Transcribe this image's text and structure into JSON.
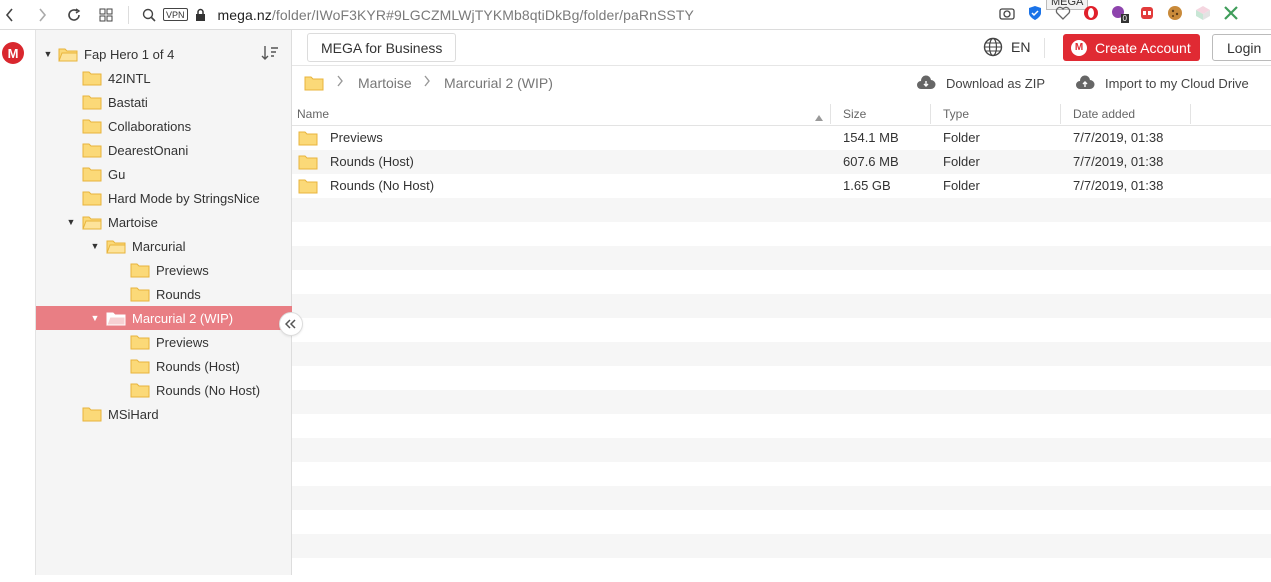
{
  "browser": {
    "url_host": "mega.nz",
    "url_path": "/folder/IWoF3KYR#9LGCZMLWjTYKMb8qtiDkBg/folder/paRnSSTY",
    "vpn_label": "VPN",
    "tooltip": "MEGA",
    "badge_count": "0"
  },
  "logo_letter": "M",
  "tree": {
    "root": "Fap Hero 1 of 4",
    "items": [
      {
        "label": "42INTL"
      },
      {
        "label": "Bastati"
      },
      {
        "label": "Collaborations"
      },
      {
        "label": "DearestOnani"
      },
      {
        "label": "Gu"
      },
      {
        "label": "Hard Mode by StringsNice"
      },
      {
        "label": "Martoise"
      },
      {
        "label": "Marcurial"
      },
      {
        "label": "Previews"
      },
      {
        "label": "Rounds"
      },
      {
        "label": "Marcurial 2 (WIP)"
      },
      {
        "label": "Previews"
      },
      {
        "label": "Rounds (Host)"
      },
      {
        "label": "Rounds (No Host)"
      },
      {
        "label": "MSiHard"
      }
    ]
  },
  "topbar": {
    "business": "MEGA for Business",
    "language": "EN",
    "create_account": "Create Account",
    "create_icon": "M",
    "login": "Login"
  },
  "breadcrumb": {
    "items": [
      "Martoise",
      "Marcurial 2 (WIP)"
    ],
    "download_zip": "Download as ZIP",
    "import": "Import to my Cloud Drive"
  },
  "table": {
    "headers": {
      "name": "Name",
      "size": "Size",
      "type": "Type",
      "date": "Date added"
    },
    "rows": [
      {
        "name": "Previews",
        "size": "154.1 MB",
        "type": "Folder",
        "date": "7/7/2019, 01:38"
      },
      {
        "name": "Rounds (Host)",
        "size": "607.6 MB",
        "type": "Folder",
        "date": "7/7/2019, 01:38"
      },
      {
        "name": "Rounds (No Host)",
        "size": "1.65 GB",
        "type": "Folder",
        "date": "7/7/2019, 01:38"
      }
    ]
  },
  "colors": {
    "brand": "#d9272e",
    "selected_row": "#e97e84",
    "folder_fill": "#fbd978",
    "folder_stroke": "#e8b43c"
  }
}
